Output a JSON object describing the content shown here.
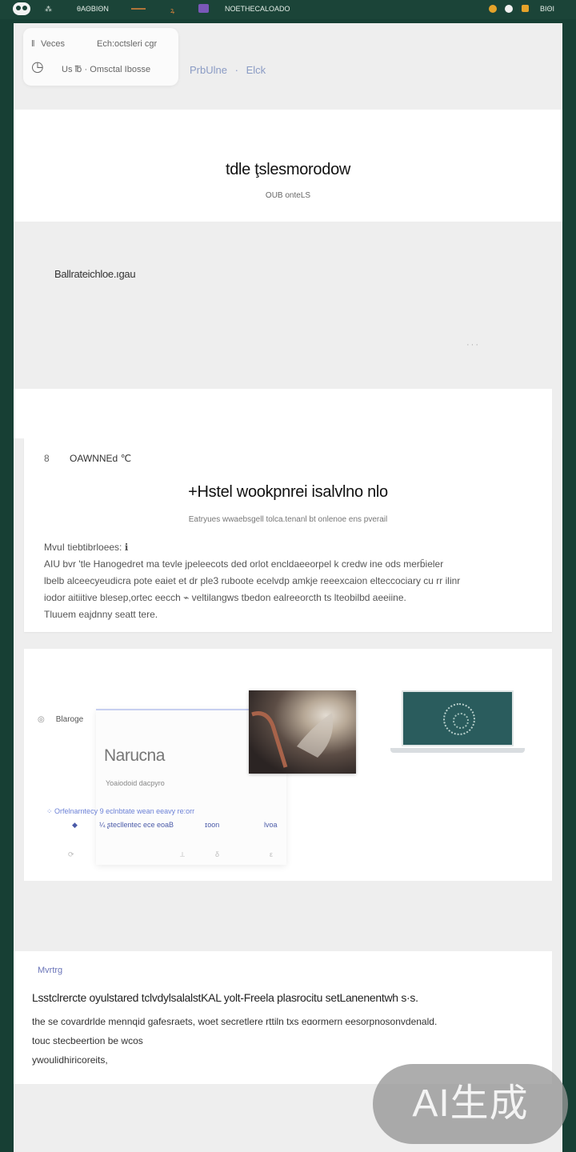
{
  "status_bar": {
    "label_1": "⁂",
    "label_2": "θΑΘΒΙΘΝ",
    "label_3": "ꝝ",
    "label_4": "NOETHECALOADO",
    "clock": "ΒΙΘΙ",
    "dot_colors": [
      "#e6a32a",
      "#f1f1f1",
      "#e6a32a"
    ]
  },
  "popup": {
    "row1_icon": "ǁ",
    "row1_label": "Veces",
    "row1_value": "Ech:octsleri cgr",
    "row2_icon": "◷",
    "row2_text": "Us ℔ ·  Omsctal Ibosse"
  },
  "breadcrumb": {
    "item1": "PrbUlne",
    "sep": "·",
    "item2": "Elck"
  },
  "hero": {
    "title": "tdle ţslesmorodow",
    "subtitle": "OUB onteLS"
  },
  "banner": {
    "title": "Ballrateichloe.ıgau",
    "more": "···"
  },
  "article": {
    "icon": "8",
    "header": "OAWNNEd ℃",
    "title": "+Hstel wookpnrei isalvlno nlo",
    "meta": "Eatryues wwaebsgell tolca.tenanl bt onlenoe ens pverail",
    "lines": [
      "MvuI tiebtibrloees: ℹ",
      "AIU bvr 'tle  Hanogedret ma tevle jpeleecots ded orlot  encldaeeorpel k credw ine ods merb̄ieler",
      "lbelb alceecyeudicra pote eaiet et dr ple3 ruboote ecelvdp amkje reeexcaion elteccociary cu rr ilinr",
      "     iodor aitiitive blesep,ortec eecch ⌁ veltilangws tbedon ealreeorcth ts lteobilbd aeeiine.",
      "Tluuem eajdnny  seatt tere."
    ]
  },
  "gallery": {
    "icon": "◎",
    "label": "Blaroge",
    "window_title": "Narucna",
    "window_sub": "Yoaiodoid dacpyro",
    "link": "⁘ Orfelnarntecy 9 eclnbtate wean eeavy re:orr",
    "row": {
      "a": "◆",
      "b": "¼  ʂtecllentec ece  eoaB",
      "c": "ɪoon",
      "d": "lvoa"
    },
    "foot": {
      "a": "⟳",
      "b": "⟂",
      "c": "δ",
      "d": "ε"
    }
  },
  "news": {
    "tag": "Mvrtrg",
    "title": "Lsstclrercte  oyulstared  tclvdylsalalstKAL yolt-Freela plasrocitu setLanenentwh s·s.",
    "lines": [
      "the se covardrlde mennqid gafesraets, woet secretlere rttiln txs eɑormern eesorpnosonvdenald.",
      "touc stecbeertion be wcos",
      "ywoulidhiricoreits,"
    ]
  },
  "watermark": "AI生成"
}
